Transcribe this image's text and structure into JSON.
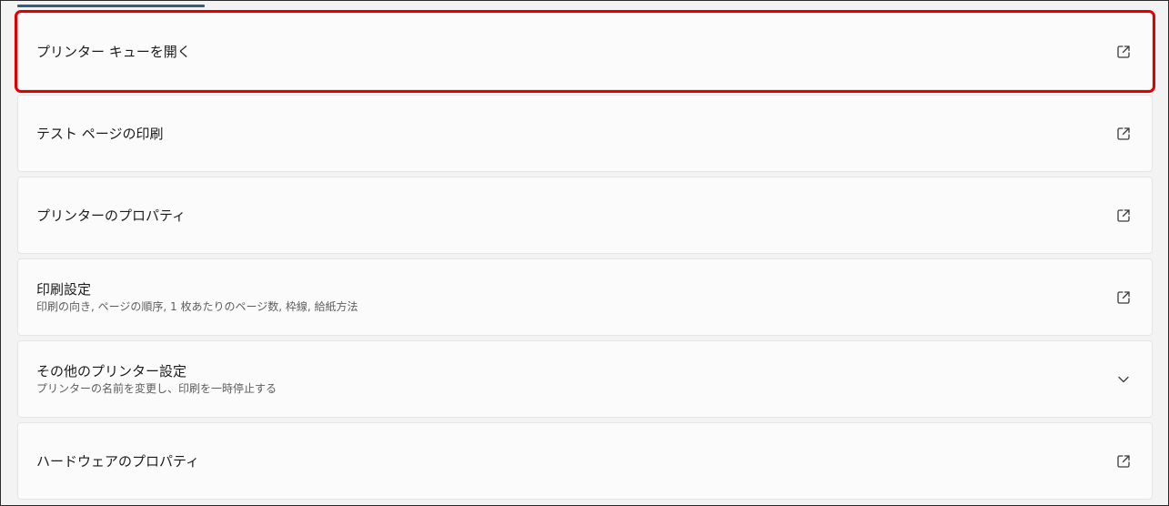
{
  "items": [
    {
      "title": "プリンター キューを開く",
      "subtitle": "",
      "icon": "external-link-icon"
    },
    {
      "title": "テスト ページの印刷",
      "subtitle": "",
      "icon": "external-link-icon"
    },
    {
      "title": "プリンターのプロパティ",
      "subtitle": "",
      "icon": "external-link-icon"
    },
    {
      "title": "印刷設定",
      "subtitle": "印刷の向き, ページの順序, 1 枚あたりのページ数, 枠線, 給紙方法",
      "icon": "external-link-icon"
    },
    {
      "title": "その他のプリンター設定",
      "subtitle": "プリンターの名前を変更し、印刷を一時停止する",
      "icon": "chevron-down-icon"
    },
    {
      "title": "ハードウェアのプロパティ",
      "subtitle": "",
      "icon": "external-link-icon"
    }
  ],
  "colors": {
    "highlight": "#e00000",
    "tab_indicator": "#2f5f7d"
  }
}
